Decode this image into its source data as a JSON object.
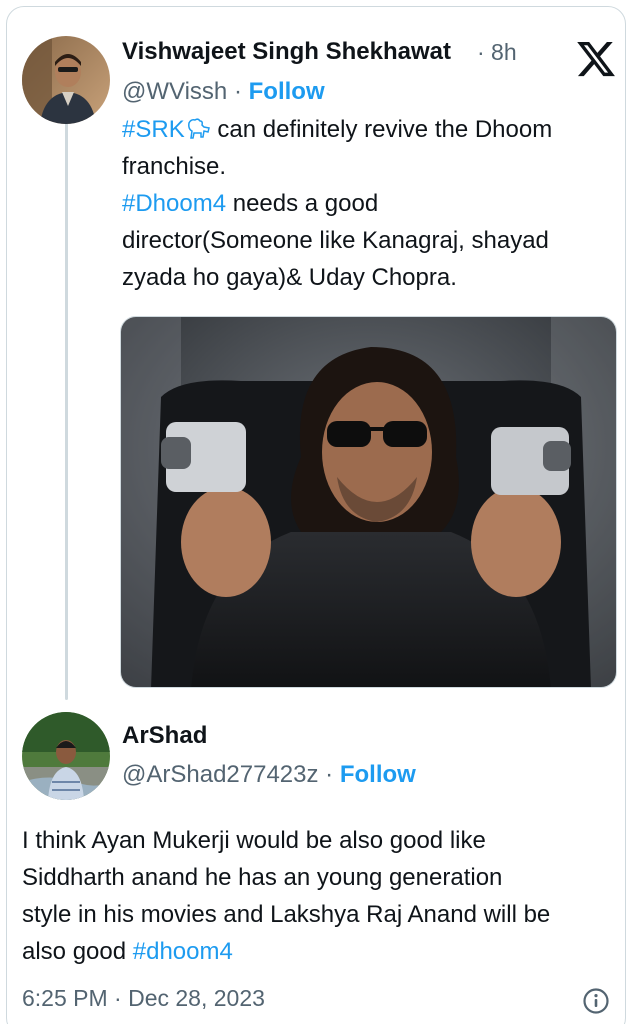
{
  "tweet": {
    "author_name": "Vishwajeet Singh Shekhawat",
    "time_ago": "· 8h",
    "handle": "@WVissh",
    "separator": "·",
    "follow_label": "Follow",
    "hashtag_srk": "#SRK",
    "text_line1_rest": " can definitely revive the Dhoom",
    "text_line2": "franchise.",
    "hashtag_dhoom4": "#Dhoom4",
    "text_line3_rest": " needs a good",
    "text_line4": "director(Someone like Kanagraj, shayad",
    "text_line5": "zyada ho gaya)& Uday Chopra.",
    "platform_logo": "x-logo-icon"
  },
  "reply": {
    "author_name": "ArShad",
    "handle": "@ArShad277423z",
    "separator": "·",
    "follow_label": "Follow",
    "text_line1": "I think Ayan Mukerji would be also good like",
    "text_line2": "Siddharth anand he has an young generation",
    "text_line3": "style in his movies and Lakshya Raj Anand will be",
    "text_line4_prefix": "also good ",
    "hashtag_dhoom4": "#dhoom4",
    "timestamp": "6:25 PM · Dec 28, 2023"
  },
  "colors": {
    "link": "#1d9bf0",
    "text": "#0f1419",
    "muted": "#536471",
    "border": "#cfd9de"
  }
}
